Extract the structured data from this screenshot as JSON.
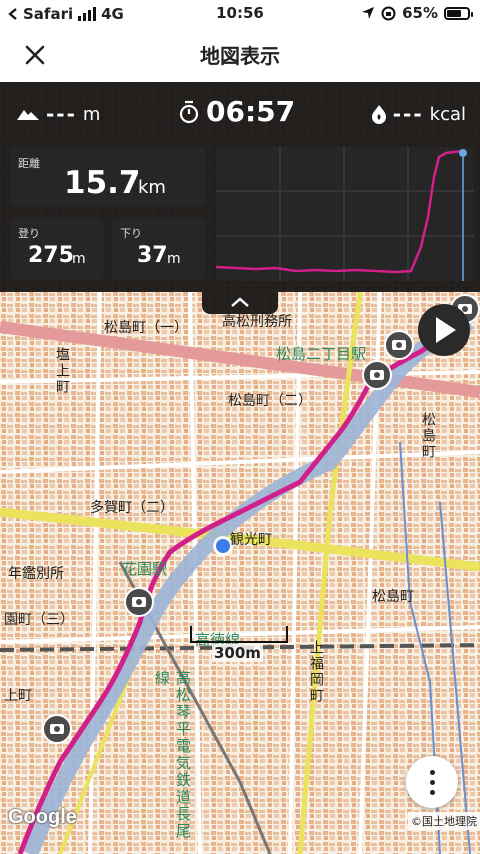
{
  "status_bar": {
    "carrier": "Safari",
    "network": "4G",
    "time": "10:56",
    "battery": "65%",
    "battery_level": 0.65
  },
  "nav": {
    "title": "地図表示",
    "close_icon": "close-icon"
  },
  "stats": {
    "altitude": "---",
    "altitude_unit": "m",
    "timer": "06:57",
    "calories": "---",
    "calories_unit": "kcal",
    "distance_label": "距離",
    "distance_value": "15.7",
    "distance_unit": "km",
    "ascent_label": "登り",
    "ascent_value": "275",
    "ascent_unit": "m",
    "descent_label": "下り",
    "descent_value": "37",
    "descent_unit": "m"
  },
  "map": {
    "labels": [
      "松島町（一）",
      "高松刑務所",
      "松島二丁目駅",
      "塩上町",
      "多賀町（二）",
      "松島町（二）",
      "観光町",
      "花園駅",
      "年鑑別所",
      "松島町",
      "園町（三）",
      "高徳線",
      "福岡町",
      "上町",
      "松島町",
      "上福岡町",
      "高松琴平電気鉄道長尾線",
      "詰田川"
    ],
    "scale": "300m",
    "google": "Google",
    "attribution": "©国土地理院"
  },
  "colors": {
    "panel_bg": "#121212",
    "route": "#d1208a",
    "river": "#9bb4d8",
    "road_main": "#e8e15a",
    "road_red": "#e49a9a",
    "location_dot": "#3b7de8"
  }
}
